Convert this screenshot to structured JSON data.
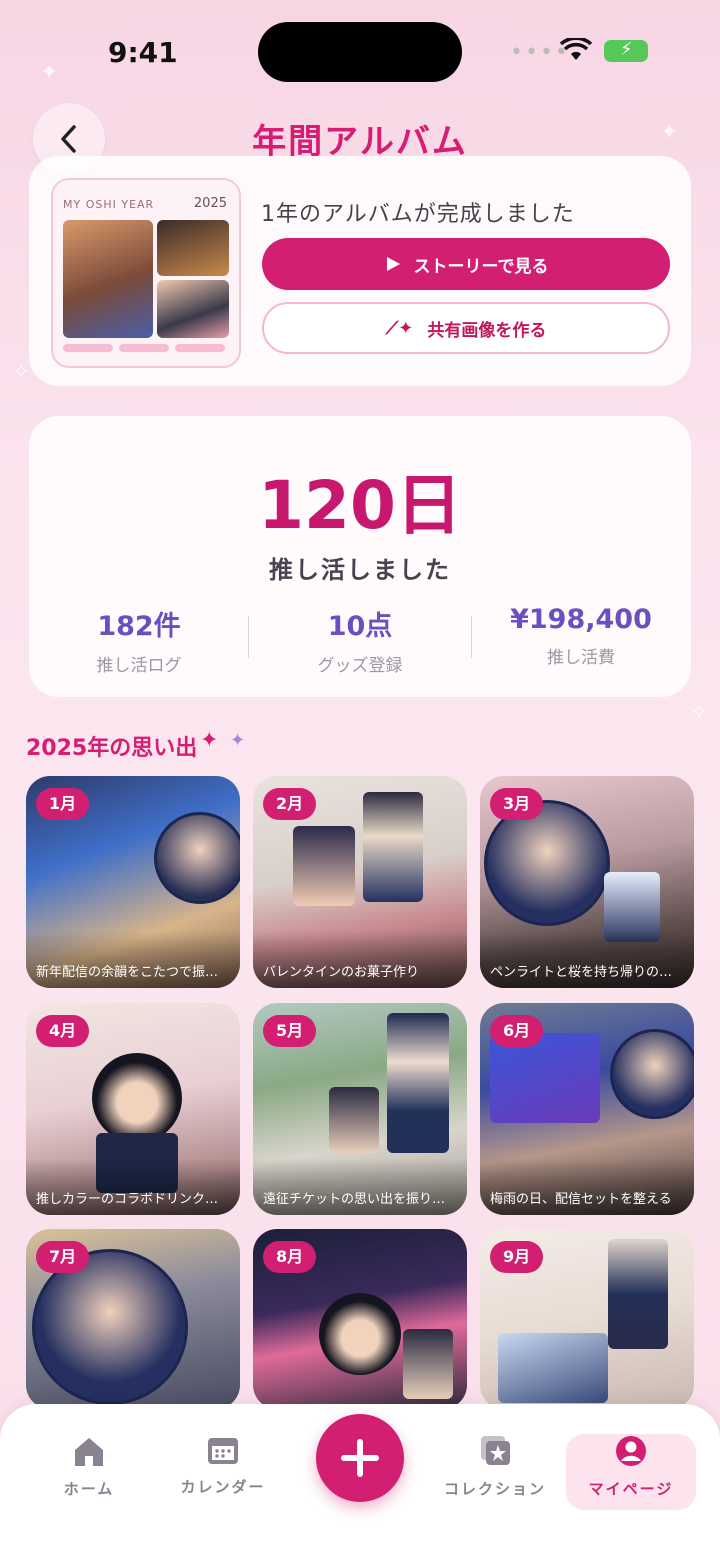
{
  "status": {
    "time": "9:41"
  },
  "header": {
    "title": "年間アルバム"
  },
  "album": {
    "thumb_title": "MY OSHI YEAR",
    "thumb_year": "2025",
    "message": "1年のアルバムが完成しました",
    "story_button": "ストーリーで見る",
    "share_button": "共有画像を作る"
  },
  "stats": {
    "days": "120日",
    "days_caption": "推し活しました",
    "items": [
      {
        "value": "182件",
        "label": "推し活ログ"
      },
      {
        "value": "10点",
        "label": "グッズ登録"
      },
      {
        "value": "¥198,400",
        "label": "推し活費"
      }
    ]
  },
  "memories": {
    "title": "2025年の思い出",
    "tiles": [
      {
        "month": "1月",
        "caption": "新年配信の余韻をこたつで振…"
      },
      {
        "month": "2月",
        "caption": "バレンタインのお菓子作り"
      },
      {
        "month": "3月",
        "caption": "ペンライトと桜を持ち帰りの…"
      },
      {
        "month": "4月",
        "caption": "推しカラーのコラボドリンク…"
      },
      {
        "month": "5月",
        "caption": "遠征チケットの思い出を振り…"
      },
      {
        "month": "6月",
        "caption": "梅雨の日、配信セットを整える"
      },
      {
        "month": "7月",
        "caption": ""
      },
      {
        "month": "8月",
        "caption": ""
      },
      {
        "month": "9月",
        "caption": ""
      }
    ]
  },
  "nav": {
    "home": "ホーム",
    "calendar": "カレンダー",
    "collection": "コレクション",
    "mypage": "マイページ"
  },
  "colors": {
    "accent": "#d21f71",
    "stat_value": "#6b4fc0"
  }
}
